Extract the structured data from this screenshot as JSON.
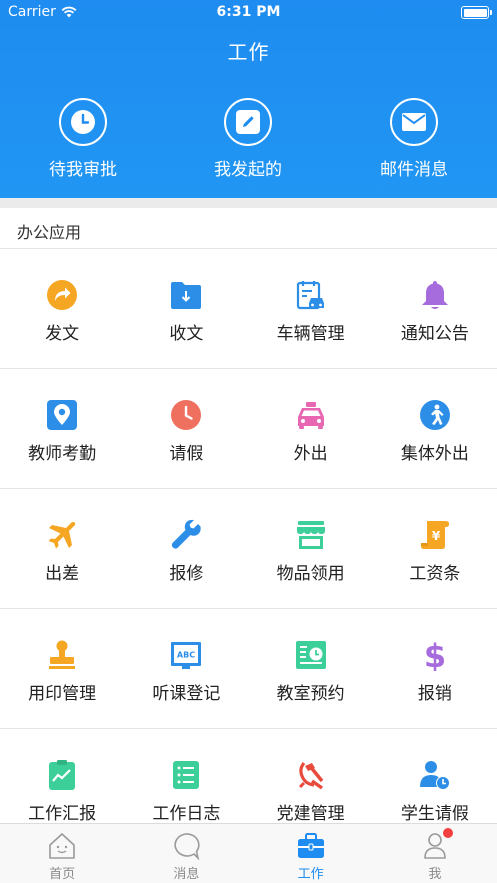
{
  "status_bar": {
    "carrier": "Carrier",
    "time": "6:31 PM"
  },
  "header": {
    "title": "工作"
  },
  "quick_actions": [
    {
      "label": "待我审批",
      "icon": "clock-icon"
    },
    {
      "label": "我发起的",
      "icon": "edit-icon"
    },
    {
      "label": "邮件消息",
      "icon": "mail-icon"
    }
  ],
  "section": {
    "title": "办公应用"
  },
  "apps": [
    {
      "label": "发文",
      "icon": "share-arrow-icon",
      "color": "#f5a623"
    },
    {
      "label": "收文",
      "icon": "folder-download-icon",
      "color": "#2d8ee8"
    },
    {
      "label": "车辆管理",
      "icon": "car-clipboard-icon",
      "color": "#2d8ee8"
    },
    {
      "label": "通知公告",
      "icon": "bell-icon",
      "color": "#a66bdc"
    },
    {
      "label": "教师考勤",
      "icon": "location-pin-icon",
      "color": "#2d8ee8"
    },
    {
      "label": "请假",
      "icon": "clock-icon",
      "color": "#f07060"
    },
    {
      "label": "外出",
      "icon": "taxi-icon",
      "color": "#e767b3"
    },
    {
      "label": "集体外出",
      "icon": "walking-person-icon",
      "color": "#2d8ee8"
    },
    {
      "label": "出差",
      "icon": "airplane-icon",
      "color": "#f5a623"
    },
    {
      "label": "报修",
      "icon": "wrench-icon",
      "color": "#2d8ee8"
    },
    {
      "label": "物品领用",
      "icon": "store-icon",
      "color": "#3ccf9a"
    },
    {
      "label": "工资条",
      "icon": "yen-scroll-icon",
      "color": "#f5a623"
    },
    {
      "label": "用印管理",
      "icon": "stamp-icon",
      "color": "#f5a623"
    },
    {
      "label": "听课登记",
      "icon": "blackboard-abc-icon",
      "color": "#2d8ee8"
    },
    {
      "label": "教室预约",
      "icon": "calendar-clock-icon",
      "color": "#3ccf9a"
    },
    {
      "label": "报销",
      "icon": "dollar-icon",
      "color": "#a66bdc"
    },
    {
      "label": "工作汇报",
      "icon": "report-chart-icon",
      "color": "#3ccf9a"
    },
    {
      "label": "工作日志",
      "icon": "list-icon",
      "color": "#3ccf9a"
    },
    {
      "label": "党建管理",
      "icon": "hammer-sickle-icon",
      "color": "#e84a3c"
    },
    {
      "label": "学生请假",
      "icon": "person-clock-icon",
      "color": "#2d8ee8"
    }
  ],
  "tabs": [
    {
      "label": "首页",
      "icon": "home-icon",
      "active": false
    },
    {
      "label": "消息",
      "icon": "chat-bubble-icon",
      "active": false
    },
    {
      "label": "工作",
      "icon": "briefcase-icon",
      "active": true
    },
    {
      "label": "我",
      "icon": "person-icon",
      "active": false
    }
  ],
  "colors": {
    "header_blue": "#1e8cf0",
    "badge_red": "#f24040"
  }
}
